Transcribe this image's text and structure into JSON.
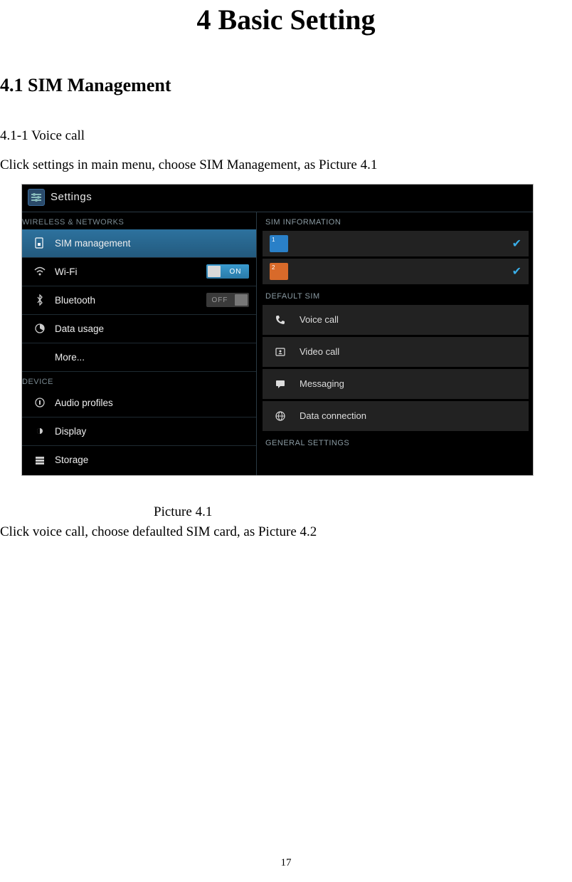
{
  "page": {
    "title": "4 Basic Setting",
    "section_heading": "4.1 SIM Management",
    "line1": "4.1-1 Voice call",
    "line2": "Click settings in main menu, choose SIM Management, as Picture 4.1",
    "caption": "Picture 4.1",
    "line3": "Click voice call, choose defaulted SIM card, as Picture 4.2",
    "page_number": "17"
  },
  "screenshot": {
    "app_title": "Settings",
    "left": {
      "cat_wireless": "WIRELESS & NETWORKS",
      "cat_device": "DEVICE",
      "items": [
        {
          "label": "SIM management"
        },
        {
          "label": "Wi-Fi",
          "toggle": "ON"
        },
        {
          "label": "Bluetooth",
          "toggle": "OFF"
        },
        {
          "label": "Data usage"
        },
        {
          "label": "More..."
        },
        {
          "label": "Audio profiles"
        },
        {
          "label": "Display"
        },
        {
          "label": "Storage"
        }
      ]
    },
    "right": {
      "hdr_sim_info": "SIM INFORMATION",
      "hdr_default": "DEFAULT SIM",
      "hdr_general": "GENERAL SETTINGS",
      "sim1_corner": "1",
      "sim2_corner": "2",
      "defaults": [
        {
          "label": "Voice call"
        },
        {
          "label": "Video call"
        },
        {
          "label": "Messaging"
        },
        {
          "label": "Data connection"
        }
      ]
    }
  }
}
